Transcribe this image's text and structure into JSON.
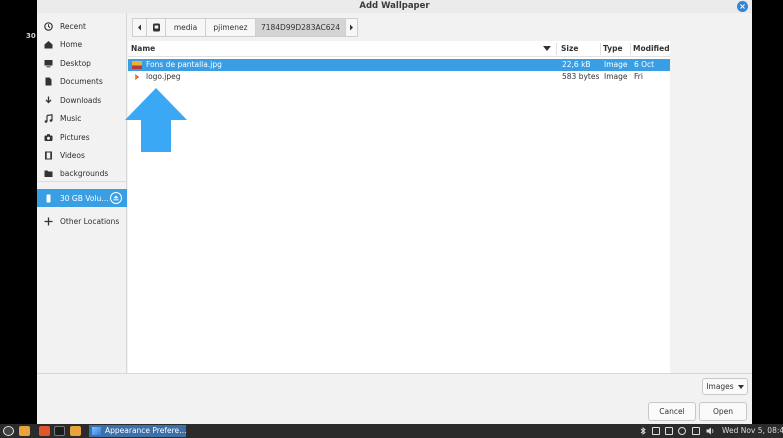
{
  "window": {
    "title": "Add Wallpaper"
  },
  "desktop": {
    "label": "30"
  },
  "sidebar": {
    "items": [
      {
        "label": "Recent",
        "icon": "clock-icon"
      },
      {
        "label": "Home",
        "icon": "home-icon"
      },
      {
        "label": "Desktop",
        "icon": "desktop-icon"
      },
      {
        "label": "Documents",
        "icon": "document-icon"
      },
      {
        "label": "Downloads",
        "icon": "download-icon"
      },
      {
        "label": "Music",
        "icon": "music-icon"
      },
      {
        "label": "Pictures",
        "icon": "camera-icon"
      },
      {
        "label": "Videos",
        "icon": "film-icon"
      },
      {
        "label": "backgrounds",
        "icon": "folder-icon"
      }
    ],
    "volume": {
      "label": "30 GB Volu…",
      "icon": "drive-icon"
    },
    "other": {
      "label": "Other Locations",
      "icon": "plus-icon"
    }
  },
  "pathbar": {
    "segments": [
      "media",
      "pjimenez",
      "7184D99D283AC624"
    ]
  },
  "columns": {
    "name": "Name",
    "size": "Size",
    "type": "Type",
    "modified": "Modified"
  },
  "files": [
    {
      "name": "Fons de pantalla.jpg",
      "size": "22,6 kB",
      "type": "Image",
      "modified": "6 Oct",
      "selected": true
    },
    {
      "name": "logo.jpeg",
      "size": "583 bytes",
      "type": "Image",
      "modified": "Fri",
      "selected": false
    }
  ],
  "filter": {
    "label": "Images"
  },
  "buttons": {
    "cancel": "Cancel",
    "open": "Open"
  },
  "taskbar": {
    "task_label": "Appearance Prefere…",
    "clock": "Wed Nov  5, 08:4"
  },
  "colors": {
    "accent": "#3a9ee4",
    "arrow": "#3aa8f5"
  }
}
